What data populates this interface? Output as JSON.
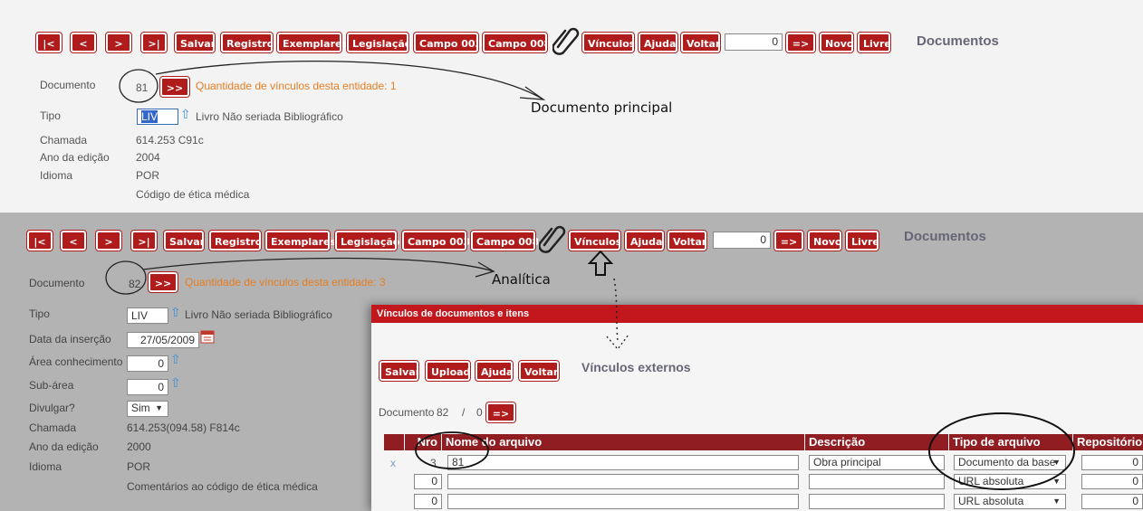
{
  "toolbar": {
    "first": "|<",
    "prev": "<",
    "next": ">",
    "last": ">|",
    "salvar": "Salvar",
    "registro": "Registro",
    "exemplares": "Exemplares",
    "legislacao": "Legislação",
    "campo003": "Campo 003",
    "campo008": "Campo 008",
    "vinculos": "Vínculos",
    "ajuda": "Ajuda",
    "voltar": "Voltar",
    "goto": "=>",
    "novo": "Novo",
    "livre": "Livre"
  },
  "top": {
    "nav_value": "0",
    "heading": "Documentos",
    "documento_label": "Documento",
    "documento_value": "81",
    "documento_btn": ">>",
    "vinculos_text": "Quantidade de vínculos desta entidade: 1",
    "tipo_label": "Tipo",
    "tipo_value": "LIV",
    "tipo_desc": "Livro  Não seriada  Bibliográfico",
    "chamada_label": "Chamada",
    "chamada_value": "614.253 C91c",
    "ano_label": "Ano da edição",
    "ano_value": "2004",
    "idioma_label": "Idioma",
    "idioma_value": "POR",
    "titulo_value": "Código de ética médica",
    "annotation": "Documento principal"
  },
  "bottom": {
    "nav_value": "0",
    "heading": "Documentos",
    "documento_label": "Documento",
    "documento_value": "82",
    "documento_btn": ">>",
    "vinculos_text": "Quantidade de vínculos desta entidade: 3",
    "annotation": "Analítica",
    "tipo_label": "Tipo",
    "tipo_value": "LIV",
    "tipo_desc": "Livro  Não seriada  Bibliográfico",
    "data_label": "Data da inserção",
    "data_value": "27/05/2009",
    "area_label": "Área conhecimento",
    "area_value": "0",
    "subarea_label": "Sub-área",
    "subarea_value": "0",
    "divulgar_label": "Divulgar?",
    "divulgar_value": "Sim",
    "chamada_label": "Chamada",
    "chamada_value": "614.253(094.58) F814c",
    "ano_label": "Ano da edição",
    "ano_value": "2000",
    "idioma_label": "Idioma",
    "idioma_value": "POR",
    "titulo_value": "Comentários ao código de ética médica"
  },
  "dialog": {
    "title": "Vínculos de documentos e itens",
    "salvar": "Salvar",
    "upload": "Upload",
    "ajuda": "Ajuda",
    "voltar": "Voltar",
    "heading": "Vínculos externos",
    "documento_label": "Documento",
    "documento_value": "82",
    "slash": "/",
    "counter": "0",
    "goto": "=>",
    "columns": [
      "Nro",
      "Nome do arquivo",
      "Descrição",
      "Tipo de arquivo",
      "Repositório"
    ],
    "rows": [
      {
        "action": "x",
        "nro": "3",
        "nome": "81",
        "descricao": "Obra principal",
        "tipo": "Documento da base",
        "repositorio": "0"
      },
      {
        "action": "",
        "nro": "0",
        "nome": "",
        "descricao": "",
        "tipo": "URL absoluta",
        "repositorio": "0"
      },
      {
        "action": "",
        "nro": "0",
        "nome": "",
        "descricao": "",
        "tipo": "URL absoluta",
        "repositorio": "0"
      }
    ]
  }
}
